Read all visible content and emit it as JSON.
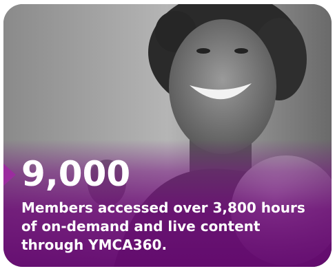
{
  "stat": {
    "number": "9,000",
    "description": "Members accessed over 3,800 hours of on-demand and live content through YMCA360."
  },
  "colors": {
    "accent": "#9b2c9f",
    "overlay": "#6e0c78",
    "text": "#ffffff"
  },
  "image": {
    "photo": "woman-smiling-punch-grayscale-photo"
  }
}
